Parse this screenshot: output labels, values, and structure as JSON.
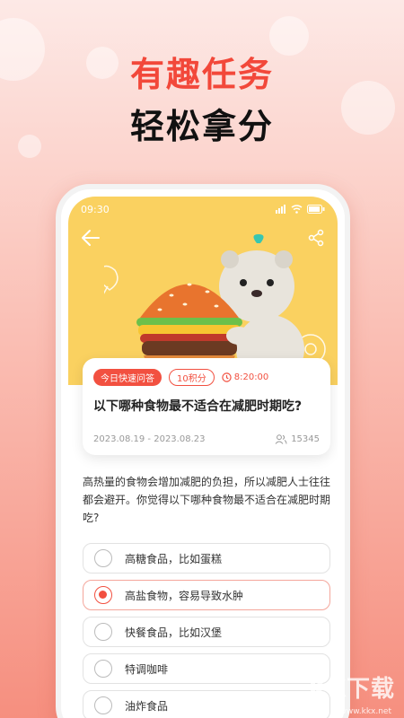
{
  "headline": {
    "line1": "有趣任务",
    "line2": "轻松拿分"
  },
  "status_bar": {
    "time": "09:30"
  },
  "question_card": {
    "tag_type": "今日快速问答",
    "tag_points": "10积分",
    "time": "8:20:00",
    "title": "以下哪种食物最不适合在减肥时期吃?",
    "date_range": "2023.08.19 - 2023.08.23",
    "participants": "15345"
  },
  "description": "高热量的食物会增加减肥的负担，所以减肥人士往往都会避开。你觉得以下哪种食物最不适合在减肥时期吃?",
  "options": [
    {
      "label": "高糖食品，比如蛋糕",
      "selected": false
    },
    {
      "label": "高盐食物，容易导致水肿",
      "selected": true
    },
    {
      "label": "快餐食品，比如汉堡",
      "selected": false
    },
    {
      "label": "特调咖啡",
      "selected": false
    },
    {
      "label": "油炸食品",
      "selected": false
    }
  ],
  "watermark": {
    "text": "KK下载",
    "url": "www.kkx.net"
  },
  "colors": {
    "accent": "#f25040",
    "hero_bg": "#fad160",
    "headline_red": "#f2483a"
  }
}
